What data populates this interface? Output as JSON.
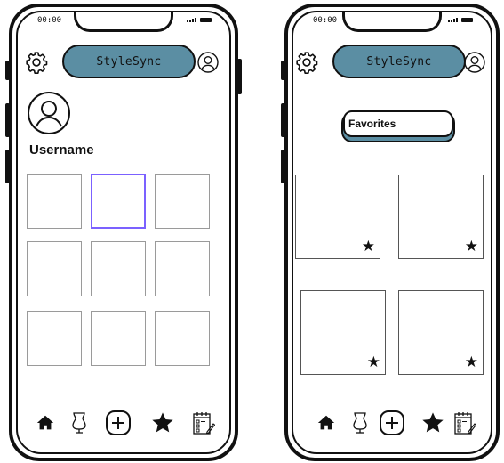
{
  "status_bar": {
    "time": "00:00"
  },
  "app": {
    "name": "StyleSync"
  },
  "profile_screen": {
    "username": "Username",
    "grid": {
      "rows": 3,
      "columns": 3,
      "selected_index": 1
    }
  },
  "favorites_screen": {
    "section_label": "Favorites",
    "cards": [
      {
        "starred": true
      },
      {
        "starred": true
      },
      {
        "starred": true
      },
      {
        "starred": true
      }
    ],
    "star_glyph": "★"
  },
  "bottom_nav": {
    "items": [
      "home-icon",
      "dress-form-icon",
      "add-icon",
      "star-icon",
      "planner-icon"
    ]
  },
  "colors": {
    "brand_teal": "#5b8ea3",
    "selection": "#7b61ff"
  }
}
